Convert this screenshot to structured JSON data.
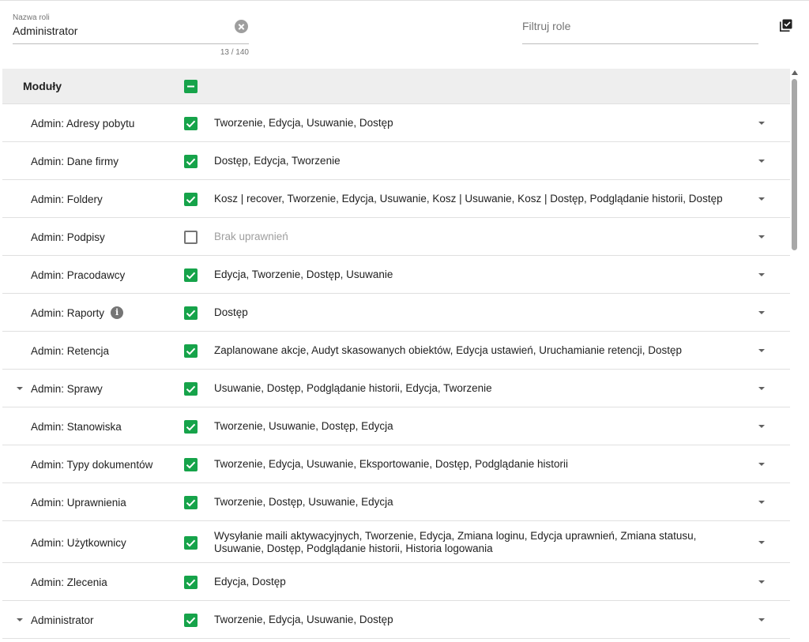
{
  "role_field": {
    "label": "Nazwa roli",
    "value": "Administrator",
    "counter": "13 / 140"
  },
  "filter": {
    "placeholder": "Filtruj role"
  },
  "header": {
    "title": "Moduły",
    "checkbox": "indeterminate"
  },
  "icons": {
    "clear": "clear-circle-icon",
    "toggle_all": "select-all-checkbox-icon",
    "info": "info-icon",
    "expand": "caret-down-icon"
  },
  "colors": {
    "accent_green": "#16a34a",
    "header_bg": "#eeeeee"
  },
  "rows": [
    {
      "name": "Admin: Adresy pobytu",
      "checked": true,
      "expandable": false,
      "info": false,
      "permissions": "Tworzenie, Edycja, Usuwanie, Dostęp"
    },
    {
      "name": "Admin: Dane firmy",
      "checked": true,
      "expandable": false,
      "info": false,
      "permissions": "Dostęp, Edycja, Tworzenie"
    },
    {
      "name": "Admin: Foldery",
      "checked": true,
      "expandable": false,
      "info": false,
      "permissions": "Kosz | recover, Tworzenie, Edycja, Usuwanie, Kosz | Usuwanie, Kosz | Dostęp, Podglądanie historii, Dostęp"
    },
    {
      "name": "Admin: Podpisy",
      "checked": false,
      "expandable": false,
      "info": false,
      "permissions": "Brak uprawnień"
    },
    {
      "name": "Admin: Pracodawcy",
      "checked": true,
      "expandable": false,
      "info": false,
      "permissions": "Edycja, Tworzenie, Dostęp, Usuwanie"
    },
    {
      "name": "Admin: Raporty",
      "checked": true,
      "expandable": false,
      "info": true,
      "permissions": "Dostęp"
    },
    {
      "name": "Admin: Retencja",
      "checked": true,
      "expandable": false,
      "info": false,
      "permissions": "Zaplanowane akcje, Audyt skasowanych obiektów, Edycja ustawień, Uruchamianie retencji, Dostęp"
    },
    {
      "name": "Admin: Sprawy",
      "checked": true,
      "expandable": true,
      "info": false,
      "permissions": "Usuwanie, Dostęp, Podglądanie historii, Edycja, Tworzenie"
    },
    {
      "name": "Admin: Stanowiska",
      "checked": true,
      "expandable": false,
      "info": false,
      "permissions": "Tworzenie, Usuwanie, Dostęp, Edycja"
    },
    {
      "name": "Admin: Typy dokumentów",
      "checked": true,
      "expandable": false,
      "info": false,
      "permissions": "Tworzenie, Edycja, Usuwanie, Eksportowanie, Dostęp, Podglądanie historii"
    },
    {
      "name": "Admin: Uprawnienia",
      "checked": true,
      "expandable": false,
      "info": false,
      "permissions": "Tworzenie, Dostęp, Usuwanie, Edycja"
    },
    {
      "name": "Admin: Użytkownicy",
      "checked": true,
      "expandable": false,
      "info": false,
      "permissions": "Wysyłanie maili aktywacyjnych, Tworzenie, Edycja, Zmiana loginu, Edycja uprawnień, Zmiana statusu, Usuwanie, Dostęp, Podglądanie historii, Historia logowania"
    },
    {
      "name": "Admin: Zlecenia",
      "checked": true,
      "expandable": false,
      "info": false,
      "permissions": "Edycja, Dostęp"
    },
    {
      "name": "Administrator",
      "checked": true,
      "expandable": true,
      "info": false,
      "permissions": "Tworzenie, Edycja, Usuwanie, Dostęp"
    }
  ]
}
